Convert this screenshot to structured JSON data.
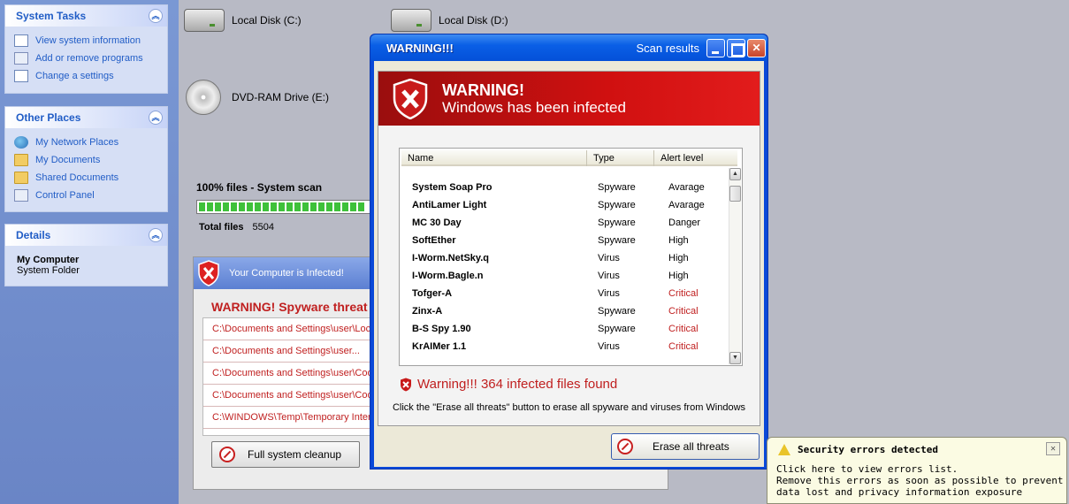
{
  "sidebar": {
    "system_tasks": {
      "title": "System Tasks",
      "items": [
        "View system information",
        "Add or remove programs",
        "Change a settings"
      ]
    },
    "other_places": {
      "title": "Other Places",
      "items": [
        "My Network Places",
        "My Documents",
        "Shared Documents",
        "Control Panel"
      ]
    },
    "details": {
      "title": "Details",
      "name": "My Computer",
      "sub": "System Folder"
    },
    "collapse_glyph": "︽"
  },
  "drives": {
    "c": "Local Disk (C:)",
    "d": "Local Disk (D:)",
    "e": "DVD-RAM Drive (E:)"
  },
  "scan": {
    "title": "100% files - System scan",
    "progress": 1.0,
    "total_label": "Total files",
    "total_value": "5504"
  },
  "infected_panel": {
    "header": "Your Computer is Infected!",
    "warning": "WARNING! Spyware threat",
    "paths": [
      "C:\\Documents and Settings\\user\\Local",
      "C:\\Documents and Settings\\user...",
      "C:\\Documents and Settings\\user\\Cookies",
      "C:\\Documents and Settings\\user\\Cookies",
      "C:\\WINDOWS\\Temp\\Temporary Internet"
    ],
    "cleanup_label": "Full system cleanup"
  },
  "dialog": {
    "title": "WARNING!!!",
    "scan_results": "Scan results",
    "close_glyph": "✕",
    "banner_title": "WARNING!",
    "banner_sub": "Windows has been infected",
    "columns": [
      "Name",
      "Type",
      "Alert level"
    ],
    "rows": [
      {
        "name": "System Soap Pro",
        "type": "Spyware",
        "alert": "Avarage"
      },
      {
        "name": "AntiLamer Light",
        "type": "Spyware",
        "alert": "Avarage"
      },
      {
        "name": "MC 30 Day",
        "type": "Spyware",
        "alert": "Danger"
      },
      {
        "name": "SoftEther",
        "type": "Spyware",
        "alert": "High"
      },
      {
        "name": "I-Worm.NetSky.q",
        "type": "Virus",
        "alert": "High"
      },
      {
        "name": "I-Worm.Bagle.n",
        "type": "Virus",
        "alert": "High"
      },
      {
        "name": "Tofger-A",
        "type": "Virus",
        "alert": "Critical"
      },
      {
        "name": "Zinx-A",
        "type": "Spyware",
        "alert": "Critical"
      },
      {
        "name": "B-S Spy 1.90",
        "type": "Spyware",
        "alert": "Critical"
      },
      {
        "name": "KrAIMer 1.1",
        "type": "Virus",
        "alert": "Critical"
      }
    ],
    "scroll_up": "▲",
    "scroll_down": "▼",
    "found_text": "Warning!!! 364 infected files found",
    "instructions": "Click the \"Erase all threats\" button to erase all spyware and viruses from Windows",
    "erase_label": "Erase all threats"
  },
  "balloon": {
    "title": "Security errors detected",
    "close_glyph": "✕",
    "lines": [
      "Click here to view errors list.",
      "Remove this errors as soon as possible to prevent",
      "data lost and privacy information exposure"
    ]
  },
  "colors": {
    "danger_red": "#c02020",
    "xp_blue": "#0a5fe6",
    "progress_green": "#3ec13a"
  }
}
